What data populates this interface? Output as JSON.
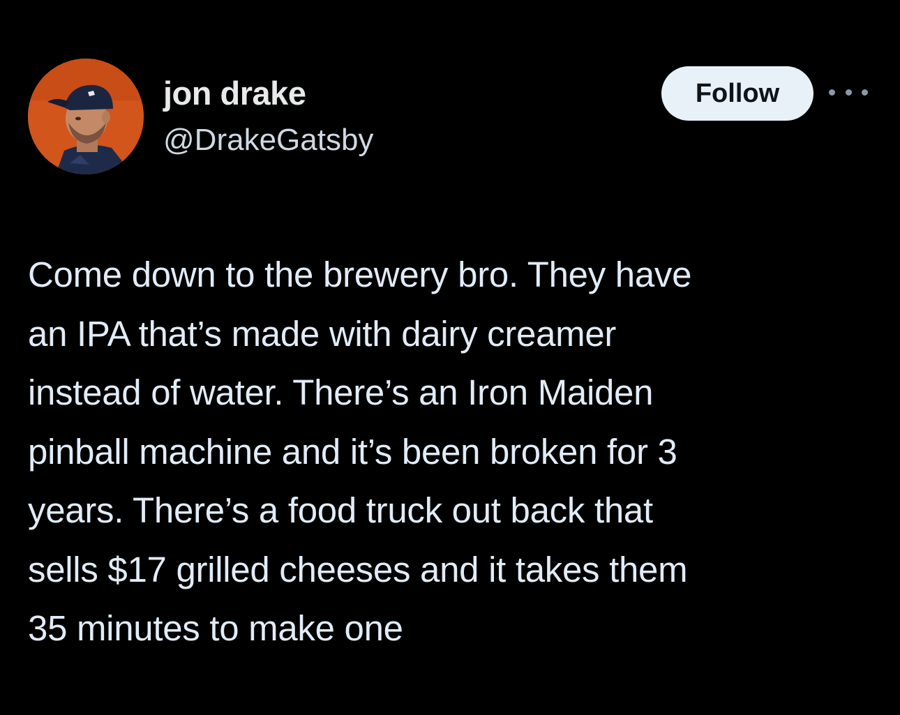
{
  "author": {
    "name": "jon drake",
    "handle": "@DrakeGatsby",
    "avatar_icon": "user-avatar-photo"
  },
  "actions": {
    "follow_label": "Follow",
    "more_icon": "more-options-icon"
  },
  "tweet": {
    "lines": [
      "Come down to the brewery bro. They have",
      "an IPA that’s made with dairy creamer",
      "instead of water. There’s an Iron Maiden",
      "pinball machine and it’s been broken for 3",
      "years. There’s a food truck out back that",
      "sells $17 grilled cheeses and it takes them",
      "35 minutes to make one"
    ]
  },
  "colors": {
    "background": "#000000",
    "text": "#e1ecf7",
    "follow_button_bg": "#e8f1f8",
    "avatar_bg": "#d2551b"
  }
}
